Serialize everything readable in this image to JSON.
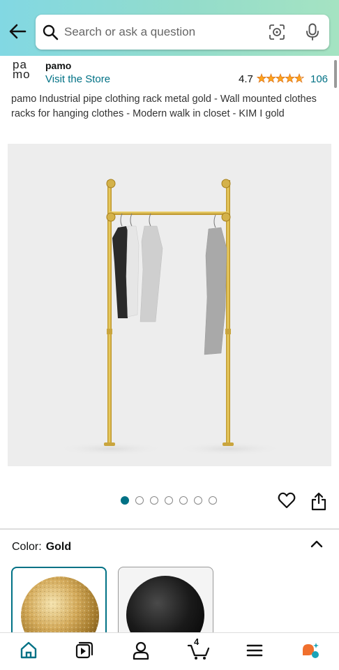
{
  "search": {
    "placeholder": "Search or ask a question"
  },
  "icons": {
    "back": "back-arrow-icon",
    "search": "search-icon",
    "lens": "camera-lens-icon",
    "mic": "microphone-icon",
    "heart": "heart-icon",
    "share": "share-icon",
    "chevron": "chevron-up-icon",
    "home": "home-icon",
    "video": "video-icon",
    "account": "account-icon",
    "cart": "cart-icon",
    "menu": "menu-icon",
    "rufus": "rufus-icon"
  },
  "brand": {
    "logo_line1": "pa",
    "logo_line2": "mo",
    "name": "pamo",
    "visit_store": "Visit the Store",
    "rating": "4.7",
    "stars_rating": 4.7,
    "review_count": "106"
  },
  "product": {
    "title": "pamo Industrial pipe clothing rack metal gold - Wall mounted clothes racks for hanging clothes - Modern walk in closet - KIM I gold"
  },
  "gallery": {
    "image_count": 7,
    "current_index": 1
  },
  "color": {
    "label": "Color:",
    "value": "Gold",
    "options": [
      "Gold",
      "Black"
    ]
  },
  "nav": {
    "cart_count": "4"
  },
  "colors": {
    "accent": "#007185",
    "star": "#ffa41c",
    "brand_gradient_start": "#82d8e3",
    "brand_gradient_end": "#a5e3c2"
  }
}
